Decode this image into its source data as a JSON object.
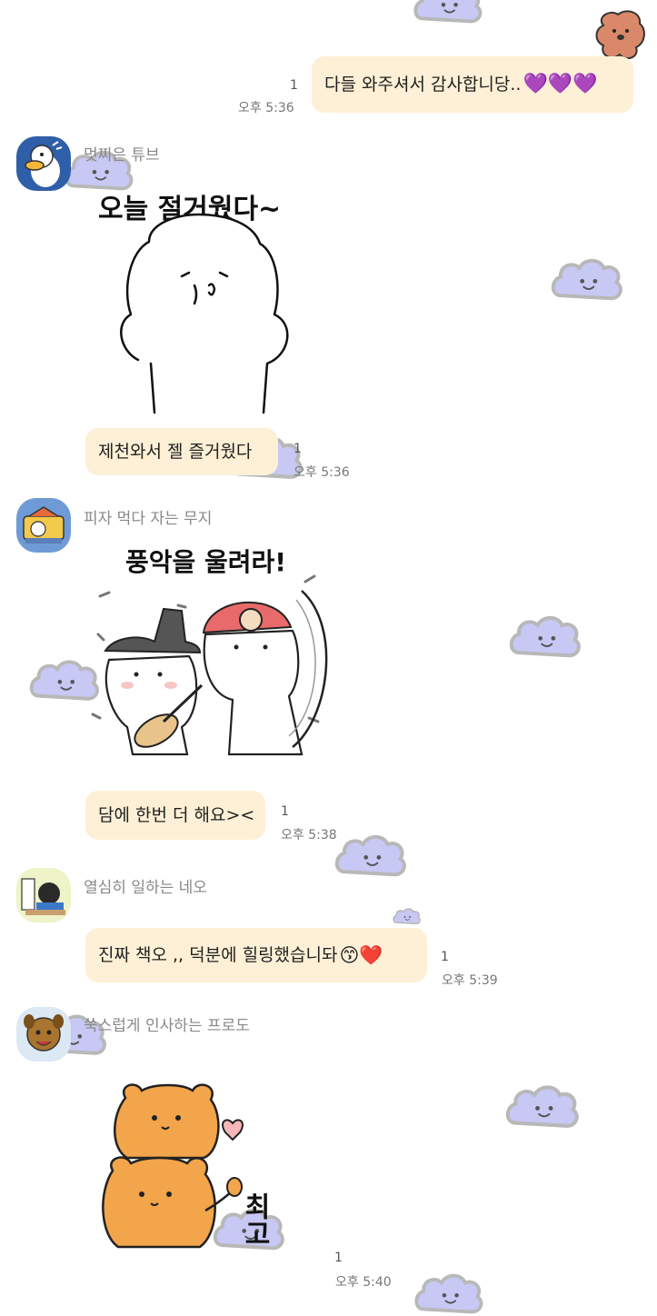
{
  "colors": {
    "bubble": "#fdf0d6",
    "cloud_fill": "#c8c8f5",
    "cloud_stroke": "#b8b8b8",
    "heart_purple": "#9b3fe8",
    "heart_red": "#e8273a"
  },
  "messages": [
    {
      "type": "outgoing",
      "text": "다들 와주셔서 감사합니당..",
      "emoji": "💜💜💜",
      "unread": "1",
      "time": "오후 5:36"
    },
    {
      "type": "incoming",
      "sender": "멋찌은 튜브",
      "avatar_icon": "tube-duck-avatar-icon",
      "sticker_caption": "오늘 절거웠다~",
      "text": "제천와서 젤 즐거웠다",
      "unread": "1",
      "time": "오후 5:36"
    },
    {
      "type": "incoming",
      "sender": "피자 먹다 자는 무지",
      "avatar_icon": "muzi-avatar-icon",
      "sticker_caption": "풍악을 울려라!",
      "text": "담에 한번 더 해요><",
      "unread": "1",
      "time": "오후 5:38"
    },
    {
      "type": "incoming",
      "sender": "열심히 일하는 네오",
      "avatar_icon": "neo-avatar-icon",
      "text": "진짜 책오 ,, 덕분에 힐링했습니돠",
      "emoji": "😙❤️",
      "unread": "1",
      "time": "오후 5:39"
    },
    {
      "type": "incoming",
      "sender": "쑥스럽게 인사하는 프로도",
      "avatar_icon": "frodo-avatar-icon",
      "sticker_caption": "최고",
      "unread": "1",
      "time": "오후 5:40"
    }
  ]
}
